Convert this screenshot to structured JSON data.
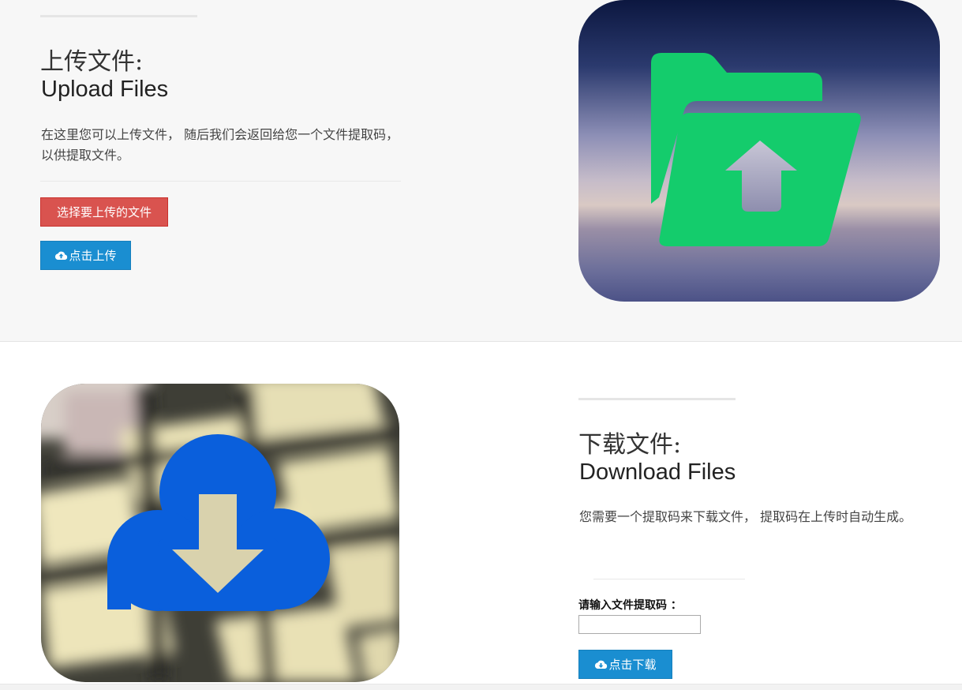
{
  "upload": {
    "title_cn": "上传文件:",
    "title_en": "Upload Files",
    "description": "在这里您可以上传文件， 随后我们会返回给您一个文件提取码，以供提取文件。",
    "choose_file_label": "选择要上传的文件",
    "upload_label": "点击上传",
    "upload_icon": "cloud-upload-icon",
    "illustration": "folder-upload-icon",
    "colors": {
      "choose_button": "#d9534f",
      "upload_button": "#1a8ed1",
      "folder": "#14cc6c"
    }
  },
  "download": {
    "title_cn": "下载文件:",
    "title_en": "Download Files",
    "description": "您需要一个提取码来下载文件， 提取码在上传时自动生成。",
    "code_label": "请输入文件提取码 ：",
    "code_value": "",
    "download_label": "点击下载",
    "download_icon": "cloud-download-icon",
    "illustration": "cloud-download-icon",
    "colors": {
      "download_button": "#1a8ed1",
      "cloud": "#0a5fdc"
    }
  }
}
